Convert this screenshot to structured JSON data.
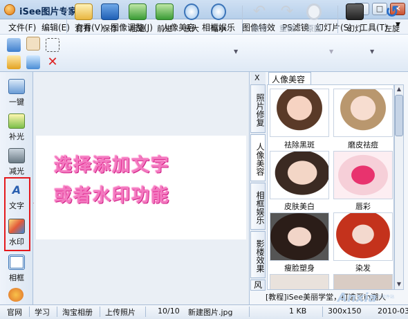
{
  "window": {
    "title": "iSee图片专家",
    "min": "–",
    "max": "□",
    "close": "✕"
  },
  "menu": [
    "文件(F)",
    "编辑(E)",
    "查看(V)",
    "图像调整(J)",
    "人像美容",
    "相框娱乐",
    "图像特效",
    "PS滤镜",
    "幻灯片(S)",
    "工具(T)"
  ],
  "toolbar": {
    "open": "打开",
    "save": "保存",
    "back": "后退",
    "forward": "前进",
    "zoom_in": "放大",
    "zoom_out": "缩小",
    "undo": "撤销",
    "redo": "重做",
    "original": "原图",
    "slideshow": "幻灯",
    "rotate_left": "左旋"
  },
  "left_panel": [
    "一键",
    "补光",
    "减光",
    "文字",
    "水印",
    "相框"
  ],
  "canvas": {
    "line1": "选择添加文字",
    "line2": "或者水印功能"
  },
  "right_panel": {
    "close": "X",
    "active_tab": "人像美容",
    "vtabs": [
      "照片修复",
      "人像美容",
      "相框娱乐",
      "影楼效果",
      "风"
    ],
    "items": [
      "祛除黑斑",
      "磨皮祛痘",
      "皮肤美白",
      "唇彩",
      "瘦脸塑身",
      "染发"
    ],
    "tip": "[教程]iSee美丽学堂，打造至in潮人"
  },
  "status": {
    "official": "官网",
    "learn": "学习",
    "taobao": "淘宝相册",
    "upload": "上传照片",
    "page": "10/10",
    "filename": "新建图片.jpg",
    "size": "1 KB",
    "dims": "300x150",
    "date": "2010-03"
  },
  "watermark": {
    "text": "Anxia",
    "sub": "安下软件站"
  },
  "colors": {
    "accent": "#2a6fc9",
    "highlight": "#e4181c",
    "overlay_text": "#f27ac0"
  }
}
